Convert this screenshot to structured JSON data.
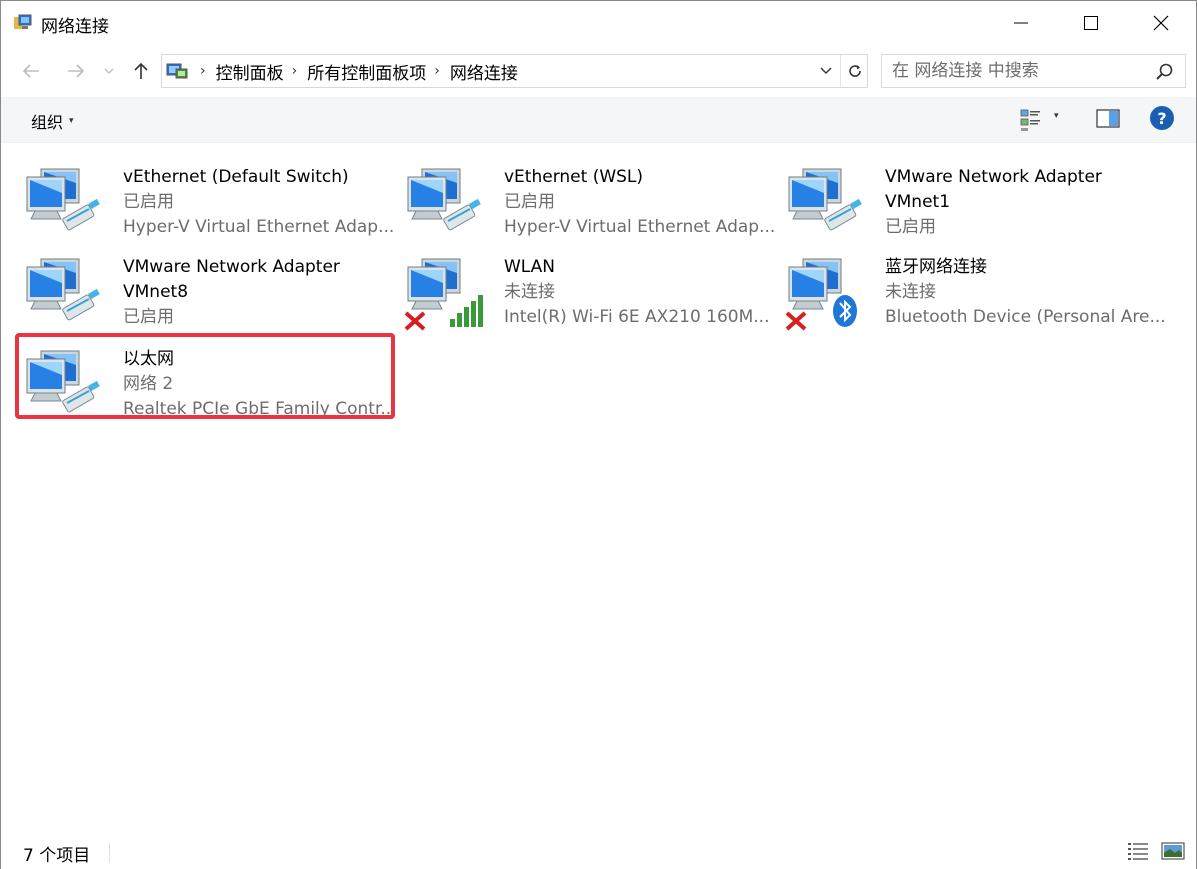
{
  "window": {
    "title": "网络连接",
    "icons": {
      "app": "network-folder-icon",
      "minimize": "minimize-icon",
      "maximize": "maximize-icon",
      "close": "close-icon"
    }
  },
  "nav": {
    "back_icon": "back-arrow-icon",
    "forward_icon": "forward-arrow-icon",
    "recent_icon": "chevron-down-icon",
    "up_icon": "up-arrow-icon"
  },
  "address": {
    "icon": "control-panel-icon",
    "crumbs": [
      "控制面板",
      "所有控制面板项",
      "网络连接"
    ],
    "dropdown_icon": "chevron-down-icon",
    "refresh_icon": "refresh-icon"
  },
  "search": {
    "placeholder": "在 网络连接 中搜索",
    "icon": "search-icon"
  },
  "toolbar": {
    "organize_label": "组织",
    "organize_caret": "▾",
    "view_caret": "▾",
    "help_label": "?"
  },
  "connections": [
    {
      "name": "vEthernet (Default Switch)",
      "line2": "已启用",
      "line3": "Hyper-V Virtual Ethernet Adap...",
      "icon": "ethernet-adapter-icon",
      "overlay": "none"
    },
    {
      "name": "vEthernet (WSL)",
      "line2": "已启用",
      "line3": "Hyper-V Virtual Ethernet Adap...",
      "icon": "ethernet-adapter-icon",
      "overlay": "none"
    },
    {
      "name": "VMware Network Adapter VMnet1",
      "line2": "已启用",
      "line3": "",
      "icon": "ethernet-adapter-icon",
      "overlay": "none"
    },
    {
      "name": "VMware Network Adapter VMnet8",
      "line2": "已启用",
      "line3": "",
      "icon": "ethernet-adapter-icon",
      "overlay": "none"
    },
    {
      "name": "WLAN",
      "line2": "未连接",
      "line3": "Intel(R) Wi-Fi 6E AX210 160M...",
      "icon": "wifi-adapter-icon",
      "overlay": "disconnected"
    },
    {
      "name": "蓝牙网络连接",
      "line2": "未连接",
      "line3": "Bluetooth Device (Personal Are...",
      "icon": "bluetooth-adapter-icon",
      "overlay": "disconnected"
    },
    {
      "name": "以太网",
      "line2": "网络 2",
      "line3": "Realtek PCIe GbE Family Contr...",
      "icon": "ethernet-adapter-icon",
      "overlay": "none",
      "selected": true
    }
  ],
  "status": {
    "count_text": "7 个项目",
    "details_view_icon": "details-view-icon",
    "large_icons_view_icon": "large-icons-view-icon"
  },
  "colors": {
    "highlight_border": "#e8353f",
    "toolbar_bg": "#f5f6f7",
    "secondary_text": "#6d6d6d"
  }
}
